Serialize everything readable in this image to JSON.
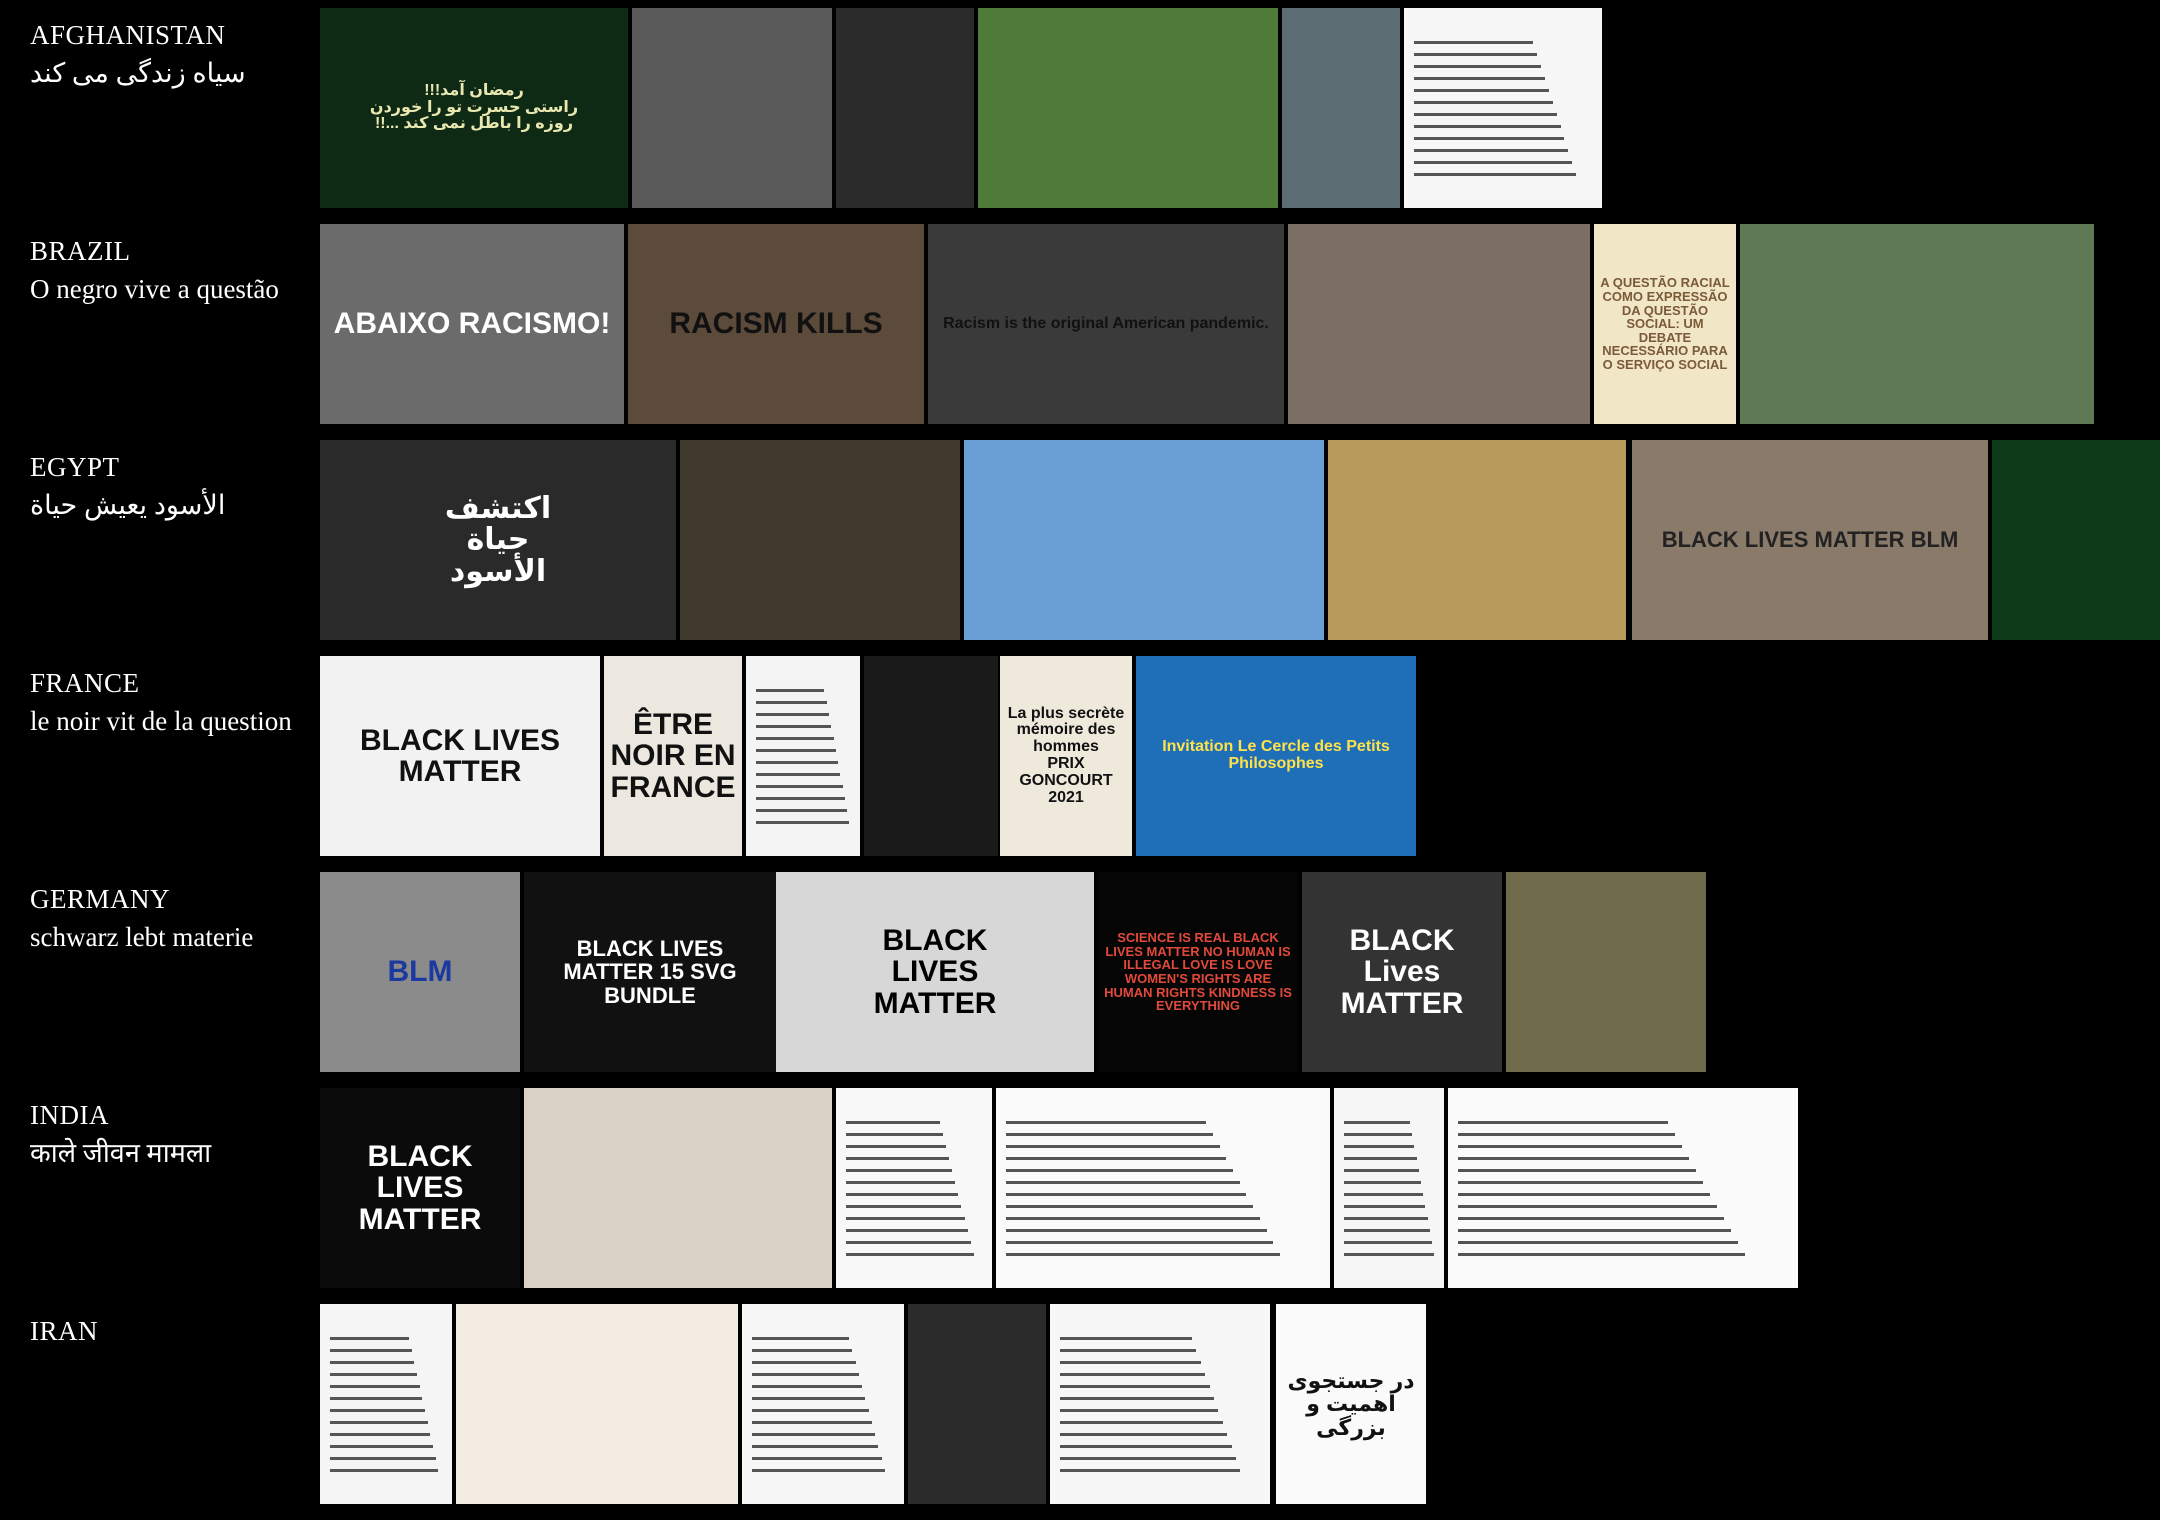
{
  "rows": [
    {
      "country": "AFGHANISTAN",
      "translation": "سیاه زندگی می کند",
      "images": [
        {
          "name": "afghanistan-image-1-ramadan-poster",
          "caption": "رمضان آمد!!!\nراستی حسرت تو را خوردن\nروزه را باطل نمی کند ...!!",
          "bg": "#0f2a14",
          "fg": "#e8e7b0"
        },
        {
          "name": "afghanistan-image-2-child-portrait",
          "caption": "",
          "bg": "#5a5a5a",
          "fg": "#fff"
        },
        {
          "name": "afghanistan-image-3-book-cover",
          "caption": "",
          "bg": "#2b2b2b",
          "fg": "#fff"
        },
        {
          "name": "afghanistan-image-4-black-bird",
          "caption": "",
          "bg": "#4e7a3a",
          "fg": "#fff"
        },
        {
          "name": "afghanistan-image-5-blossom-sign",
          "caption": "",
          "bg": "#5b6c72",
          "fg": "#fff"
        },
        {
          "name": "afghanistan-image-6-document",
          "caption": "",
          "bg": "#f7f7f7",
          "fg": "#333"
        }
      ]
    },
    {
      "country": "BRAZIL",
      "translation": "O negro vive a questão",
      "images": [
        {
          "name": "brazil-image-1-protest-abaixo-racismo",
          "caption": "ABAIXO RACISMO!",
          "bg": "#6b6b6b",
          "fg": "#fff"
        },
        {
          "name": "brazil-image-2-racism-kills-sign",
          "caption": "RACISM KILLS",
          "bg": "#5c4a3a",
          "fg": "#111"
        },
        {
          "name": "brazil-image-3-racism-pandemic-sign",
          "caption": "Racism is the original American pandemic.",
          "bg": "#3a3a3a",
          "fg": "#111"
        },
        {
          "name": "brazil-image-4-street-queue",
          "caption": "",
          "bg": "#7b6f64",
          "fg": "#fff"
        },
        {
          "name": "brazil-image-5-questao-racial-book",
          "caption": "A QUESTÃO RACIAL COMO EXPRESSÃO DA QUESTÃO SOCIAL: UM DEBATE NECESSÁRIO PARA O SERVIÇO SOCIAL",
          "bg": "#f1e7c6",
          "fg": "#7a5a3a"
        },
        {
          "name": "brazil-image-6-woman-garden",
          "caption": "",
          "bg": "#5e7a54",
          "fg": "#fff"
        }
      ]
    },
    {
      "country": "EGYPT",
      "translation": "الأسود يعيش حياة",
      "images": [
        {
          "name": "egypt-image-1-lion-discover-poster",
          "caption": "اكتشف\nحياة\nالأسود",
          "bg": "#2a2a2a",
          "fg": "#fff"
        },
        {
          "name": "egypt-image-2-man-with-lion",
          "caption": "",
          "bg": "#3f3a2c",
          "fg": "#fff"
        },
        {
          "name": "egypt-image-3-lions-savanna",
          "caption": "",
          "bg": "#6a9fd6",
          "fg": "#fff"
        },
        {
          "name": "egypt-image-4-lioness-cubs",
          "caption": "",
          "bg": "#b89a5c",
          "fg": "#fff"
        },
        {
          "name": "egypt-image-5-blm-protest",
          "caption": "BLACK LIVES MATTER   BLM",
          "bg": "#8a7a6a",
          "fg": "#222"
        },
        {
          "name": "egypt-image-6-black-panther",
          "caption": "",
          "bg": "#0f3a1a",
          "fg": "#fff"
        }
      ]
    },
    {
      "country": "FRANCE",
      "translation": "le noir vit de la question",
      "images": [
        {
          "name": "france-image-1-black-kitten",
          "caption": "BLACK LIVES MATTER",
          "bg": "#f2f2f2",
          "fg": "#111"
        },
        {
          "name": "france-image-2-etre-noir-en-france",
          "caption": "ÊTRE NOIR EN FRANCE",
          "bg": "#ece7df",
          "fg": "#111"
        },
        {
          "name": "france-image-3-text-page",
          "caption": "",
          "bg": "#f4f4f4",
          "fg": "#333"
        },
        {
          "name": "france-image-4-book-back",
          "caption": "",
          "bg": "#1a1a1a",
          "fg": "#ddd"
        },
        {
          "name": "france-image-5-prix-goncourt-book",
          "caption": "La plus secrète mémoire des hommes\nPRIX GONCOURT 2021",
          "bg": "#efe9dc",
          "fg": "#111"
        },
        {
          "name": "france-image-6-petits-philosophes",
          "caption": "Invitation  Le Cercle des Petits Philosophes",
          "bg": "#1f6fb8",
          "fg": "#ffe14a"
        }
      ]
    },
    {
      "country": "GERMANY",
      "translation": "schwarz lebt materie",
      "images": [
        {
          "name": "germany-image-1-blm-tshirt",
          "caption": "BLM",
          "bg": "#8b8b8b",
          "fg": "#1a3aa0"
        },
        {
          "name": "germany-image-2-blm-svg-bundle",
          "caption": "BLACK LIVES MATTER  15 SVG BUNDLE",
          "bg": "#111",
          "fg": "#fff"
        },
        {
          "name": "germany-image-3-black-lives-matter-flag",
          "caption": "BLACK\nLIVES\nMATTER",
          "bg": "#d7d7d7",
          "fg": "#000"
        },
        {
          "name": "germany-image-4-science-is-real-poster",
          "caption": "SCIENCE IS REAL BLACK LIVES MATTER NO HUMAN IS ILLEGAL LOVE IS LOVE WOMEN'S RIGHTS ARE HUMAN RIGHTS KINDNESS IS EVERYTHING",
          "bg": "#050505",
          "fg": "#e14a3a"
        },
        {
          "name": "germany-image-5-black-lives-matter-badge",
          "caption": "BLACK Lives MATTER",
          "bg": "#333",
          "fg": "#fff"
        },
        {
          "name": "germany-image-6-patched-jacket",
          "caption": "",
          "bg": "#6f6a4a",
          "fg": "#fff"
        }
      ]
    },
    {
      "country": "INDIA",
      "translation": "काले जीवन मामला",
      "images": [
        {
          "name": "india-image-1-fist-black-lives-matter",
          "caption": "BLACK LIVES MATTER",
          "bg": "#0b0b0b",
          "fg": "#fff"
        },
        {
          "name": "india-image-2-hindi-collage",
          "caption": "",
          "bg": "#d9d2c4",
          "fg": "#333"
        },
        {
          "name": "india-image-3-document",
          "caption": "",
          "bg": "#f8f8f8",
          "fg": "#333"
        },
        {
          "name": "india-image-4-handwritten-letter",
          "caption": "",
          "bg": "#fafafa",
          "fg": "#333"
        },
        {
          "name": "india-image-5-document",
          "caption": "",
          "bg": "#f6f6f6",
          "fg": "#333"
        },
        {
          "name": "india-image-6-official-letter",
          "caption": "",
          "bg": "#fbfbfb",
          "fg": "#333"
        }
      ]
    },
    {
      "country": "IRAN",
      "translation": "",
      "images": [
        {
          "name": "iran-image-1-text-page",
          "caption": "",
          "bg": "#f5f5f5",
          "fg": "#333"
        },
        {
          "name": "iran-image-2-illustrated-page",
          "caption": "",
          "bg": "#f2ece2",
          "fg": "#333"
        },
        {
          "name": "iran-image-3-text-page",
          "caption": "",
          "bg": "#f7f7f7",
          "fg": "#333"
        },
        {
          "name": "iran-image-4-book-cover",
          "caption": "",
          "bg": "#2b2b2b",
          "fg": "#fff"
        },
        {
          "name": "iran-image-5-table-page",
          "caption": "",
          "bg": "#f7f7f7",
          "fg": "#333"
        },
        {
          "name": "iran-image-6-title-page",
          "caption": "در جستجوی اهمیت و بزرگی",
          "bg": "#fafafa",
          "fg": "#111"
        }
      ]
    }
  ]
}
